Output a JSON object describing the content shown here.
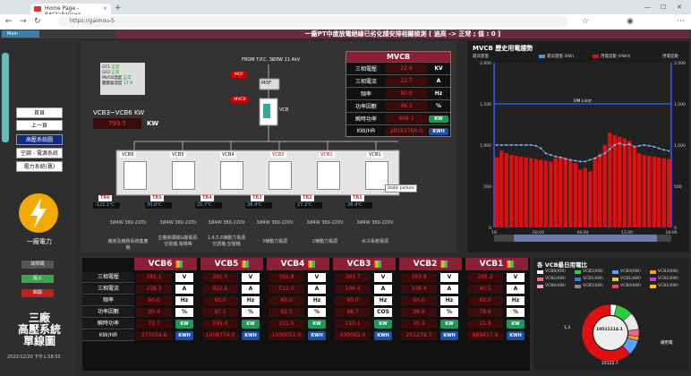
{
  "browser": {
    "tab_title": "Home Page - BACtalkViews",
    "url": "https://gaimou-5"
  },
  "appbar": {
    "side_button": "Main",
    "banner": "一廠PT中度放電絕緣已劣化請安排相關檢測 [ 過高 -> 正常 ; 值 : 0 ]"
  },
  "left": {
    "nav": [
      "首頁",
      "上一頁",
      "高壓系統圖",
      "空調 - 電源系統",
      "電力系統(舊)"
    ],
    "logo_text": "一廠電力",
    "btn_gray": "故障碼",
    "btn_green": "投入",
    "btn_red": "斷開",
    "title_lines": [
      "三廠",
      "高壓系統",
      "單線圖"
    ],
    "datetime": "2022/12/20 下午1:58:55"
  },
  "diagram": {
    "status_rows": [
      {
        "label": "GF1",
        "val": "正常"
      },
      {
        "label": "GF2",
        "val": "正常"
      },
      {
        "label": "MVCB溫度",
        "val": "正常"
      },
      {
        "label": "變壓器溫度",
        "val": "17.9"
      }
    ],
    "from_text": "FROM T.P.C. 3Ø3W 11.4kV",
    "sum_label": "VCB3~VCB6 KW",
    "sum_value": "799.5",
    "sum_unit": "KW",
    "mof": "MOF",
    "mof2": "MOF",
    "mvcb_tag": "MVCB",
    "vcb": "VCB",
    "feeders": [
      {
        "tag": "VCB6",
        "tr": "TR6",
        "temp": "-122.1℃",
        "spec": "3Ø4W 380-220V",
        "desc": "廠房及廠務系統集塵機"
      },
      {
        "tag": "VCB5",
        "tr": "TR5",
        "temp": "30.0℃",
        "spec": "3Ø4W 380-220V",
        "desc": "主機房開關&廠電源,空壓機,電梯等"
      },
      {
        "tag": "VCB4",
        "tr": "TR4",
        "temp": "25.7℃",
        "spec": "3Ø4W 380-220V",
        "desc": "1,4,5,6棟動力電源 空調機,空壓機"
      },
      {
        "tag": "VCB3",
        "tr": "TR3",
        "temp": "28.4℃",
        "spec": "3Ø4W 380-220V",
        "desc": "3棟動力電源"
      },
      {
        "tag": "VCB2",
        "tr": "TR2",
        "temp": "27.2℃",
        "spec": "3Ø4W 380-220V",
        "desc": "2棟動力電源"
      },
      {
        "tag": "VCB1",
        "tr": "TR1",
        "temp": "28.4℃",
        "spec": "3Ø4W 380-220V",
        "desc": "水冷系統電源"
      }
    ],
    "tooltip": "static picture"
  },
  "mvcb": {
    "title": "MVCB",
    "rows": [
      {
        "label": "三相電壓",
        "value": "22.9",
        "unit": "KV"
      },
      {
        "label": "三相電流",
        "value": "22.7",
        "unit": "A"
      },
      {
        "label": "頻率",
        "value": "60.0",
        "unit": "Hz"
      },
      {
        "label": "功率因數",
        "value": "96.3",
        "unit": "%"
      },
      {
        "label": "瞬時功率",
        "value": "869.1",
        "unit": "KW"
      },
      {
        "label": "KW/HR",
        "value": "29163760.0",
        "unit": "KWH"
      }
    ]
  },
  "chart_data": {
    "type": "bar",
    "title": "MVCB 歷史用電趨勢",
    "ylabel_left": "最高需量",
    "ylabel_right": "用電度數",
    "legend": [
      "最高需量 (KW)",
      "用電度數 (KWH)"
    ],
    "limit_label": "DM Limit",
    "limit_value": 1500,
    "ylim": [
      0,
      2000
    ],
    "yticks": [
      "2,000",
      "1,500",
      "1,000",
      "500",
      "0"
    ],
    "xticks": [
      "18",
      "00:00",
      "06:00",
      "12:00",
      "18:00"
    ],
    "series": [
      {
        "name": "用電度數 (KWH)",
        "values": [
          850,
          930,
          900,
          880,
          870,
          860,
          850,
          840,
          830,
          820,
          810,
          800,
          840,
          860,
          850,
          820,
          780,
          700,
          720,
          680,
          850,
          900,
          1000,
          1150,
          1120,
          1100,
          1080,
          1050,
          980,
          900,
          880,
          870,
          860,
          850,
          840,
          830
        ]
      },
      {
        "name": "最高需量 (KW)",
        "values": [
          1000,
          1000,
          1000,
          1000,
          1000,
          1000,
          1000,
          1000,
          990,
          960,
          900,
          880,
          860,
          850,
          830,
          820,
          810,
          800,
          800,
          820,
          840,
          870,
          900,
          950,
          1000,
          1020,
          1000,
          1010,
          980,
          990,
          1000,
          990,
          980,
          960,
          940,
          930
        ]
      }
    ],
    "colors": {
      "bar": "#e01010",
      "line": "#5a8fd8",
      "limit": "#2a5bd7",
      "axis": "#3b5cff"
    }
  },
  "table": {
    "headers": [
      "VCB6",
      "VCB5",
      "VCB4",
      "VCB3",
      "VCB2",
      "VCB1"
    ],
    "row_labels": [
      "三相電壓",
      "三相電流",
      "頻率",
      "功率因數",
      "瞬時功率",
      "KW/HR"
    ],
    "units": [
      "V",
      "A",
      "Hz",
      "%",
      "KW",
      "KWH"
    ],
    "cos_label": "COS",
    "values": [
      [
        "381.1",
        "391.5",
        "392.8",
        "393.7",
        "393.8",
        "395.2"
      ],
      [
        "228.3",
        "922.6",
        "512.0",
        "108.4",
        "108.4",
        "40.5"
      ],
      [
        "60.0",
        "60.0",
        "60.0",
        "60.0",
        "60.0",
        "60.0"
      ],
      [
        "95.4",
        "97.1",
        "92.5",
        "98.7",
        "98.8",
        "78.9"
      ],
      [
        "72.7",
        "595.0",
        "331.5",
        "110.1",
        "70.3",
        "21.8"
      ],
      [
        "373559.8",
        "1008774.0",
        "1030051.0",
        "430062.0",
        "251279.7",
        "889417.9"
      ]
    ]
  },
  "pie": {
    "title": "各 VCB最日用電比",
    "legend": [
      {
        "name": "VCB6(KW)",
        "color": "#ffffff"
      },
      {
        "name": "VCB5(KW)",
        "color": "#2ecc40"
      },
      {
        "name": "VCB4(KW)",
        "color": "#5aa0ff"
      },
      {
        "name": "VCB3(KW)",
        "color": "#f0a020"
      },
      {
        "name": "VCB2(KW)",
        "color": "#f06a80"
      },
      {
        "name": "VCB1(KW)",
        "color": "#3a7ad0"
      },
      {
        "name": "VCB1(KW)",
        "color": "#e0d020"
      },
      {
        "name": "VCB1(KW)",
        "color": "#c040c0"
      },
      {
        "name": "VCB6(KW)",
        "color": "#ff99cc"
      },
      {
        "name": "VCB5(KW)",
        "color": "#888888"
      },
      {
        "name": "VCB4(KW)",
        "color": "#ff4444"
      },
      {
        "name": "VCB1(KW)",
        "color": "#ffcc00"
      }
    ],
    "center_value": "10511114.1",
    "label_left": "1,3",
    "label_right": "總用電",
    "label_bottom": "25112.7",
    "slices": [
      3.5,
      9.6,
      9.8,
      4.1,
      2.4,
      8.5,
      62.1
    ],
    "slice_colors": [
      "#ffffff",
      "#2ecc40",
      "#e8e8e8",
      "#f06a80",
      "#f0a020",
      "#5aa0ff",
      "#e01010"
    ]
  }
}
